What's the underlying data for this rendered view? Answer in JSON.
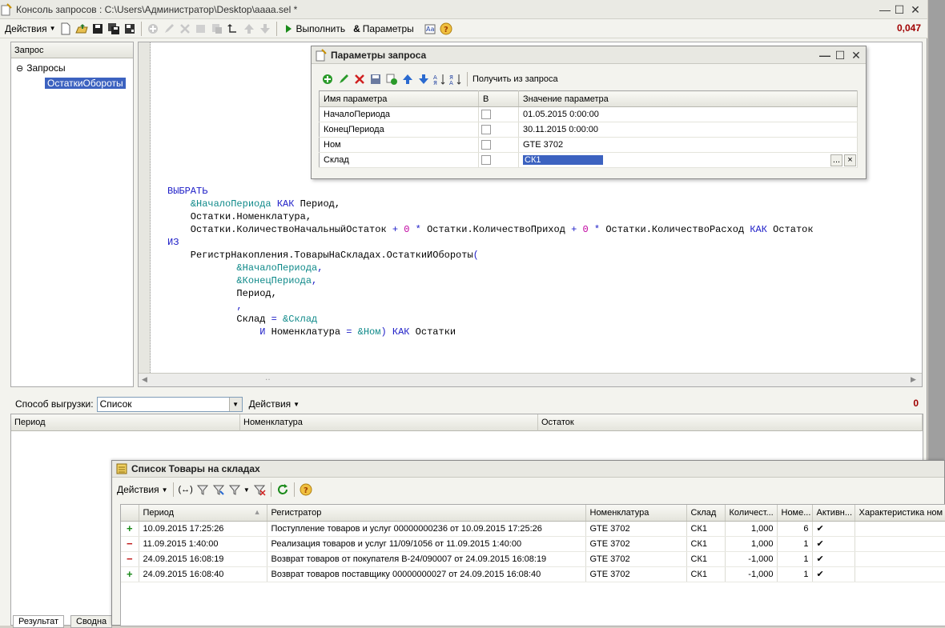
{
  "main_window": {
    "title": "Консоль запросов : C:\\Users\\Администратор\\Desktop\\aaaa.sel *"
  },
  "toolbar": {
    "actions_label": "Действия",
    "execute_label": "Выполнить",
    "parameters_label": "Параметры",
    "elapsed": "0,047"
  },
  "tree": {
    "header": "Запрос",
    "root": "Запросы",
    "selected": "ОстаткиОбороты"
  },
  "query_code": [
    [
      {
        "t": "ВЫБРАТЬ",
        "c": "kw"
      }
    ],
    [
      {
        "t": "    "
      },
      {
        "t": "&НачалоПериода",
        "c": "pr"
      },
      {
        "t": " "
      },
      {
        "t": "КАК",
        "c": "kw"
      },
      {
        "t": " Период,"
      }
    ],
    [
      {
        "t": "    Остатки.Номенклатура,"
      }
    ],
    [
      {
        "t": "    Остатки.КоличествоНачальныйОстаток "
      },
      {
        "t": "+",
        "c": "kw"
      },
      {
        "t": " "
      },
      {
        "t": "0",
        "c": "op"
      },
      {
        "t": " "
      },
      {
        "t": "*",
        "c": "kw"
      },
      {
        "t": " Остатки.КоличествоПриход "
      },
      {
        "t": "+",
        "c": "kw"
      },
      {
        "t": " "
      },
      {
        "t": "0",
        "c": "op"
      },
      {
        "t": " "
      },
      {
        "t": "*",
        "c": "kw"
      },
      {
        "t": " Остатки.КоличествоРасход "
      },
      {
        "t": "КАК",
        "c": "kw"
      },
      {
        "t": " Остаток"
      }
    ],
    [
      {
        "t": "ИЗ",
        "c": "kw"
      }
    ],
    [
      {
        "t": "    РегистрНакопления.ТоварыНаСкладах.ОстаткиИОбороты"
      },
      {
        "t": "(",
        "c": "kw"
      }
    ],
    [
      {
        "t": "            "
      },
      {
        "t": "&НачалоПериода",
        "c": "pr"
      },
      {
        "t": ",",
        "c": "kw"
      }
    ],
    [
      {
        "t": "            "
      },
      {
        "t": "&КонецПериода",
        "c": "pr"
      },
      {
        "t": ",",
        "c": "kw"
      }
    ],
    [
      {
        "t": "            Период,"
      }
    ],
    [
      {
        "t": "            "
      },
      {
        "t": ",",
        "c": "kw"
      }
    ],
    [
      {
        "t": "            Склад "
      },
      {
        "t": "=",
        "c": "kw"
      },
      {
        "t": " "
      },
      {
        "t": "&Склад",
        "c": "pr"
      }
    ],
    [
      {
        "t": "                "
      },
      {
        "t": "И",
        "c": "kw"
      },
      {
        "t": " Номенклатура "
      },
      {
        "t": "=",
        "c": "kw"
      },
      {
        "t": " "
      },
      {
        "t": "&Ном",
        "c": "pr"
      },
      {
        "t": ")",
        "c": "kw"
      },
      {
        "t": " "
      },
      {
        "t": "КАК",
        "c": "kw"
      },
      {
        "t": " Остатки"
      }
    ]
  ],
  "params_dialog": {
    "title": "Параметры запроса",
    "get_from_query_label": "Получить из запроса",
    "columns": [
      "Имя параметра",
      "В",
      "Значение параметра"
    ],
    "rows": [
      {
        "name": "НачалоПериода",
        "value": "01.05.2015 0:00:00"
      },
      {
        "name": "КонецПериода",
        "value": "30.11.2015 0:00:00"
      },
      {
        "name": "Ном",
        "value": "GTE 3702"
      },
      {
        "name": "Склад",
        "value": "СК1"
      }
    ],
    "ellipsis_label": "...",
    "clear_label": "×"
  },
  "result": {
    "export_label": "Способ выгрузки:",
    "export_value": "Список",
    "actions_label": "Действия",
    "count": "0",
    "columns": [
      "Период",
      "Номенклатура",
      "Остаток"
    ],
    "tabs": [
      "Результат",
      "Сводна"
    ]
  },
  "list_window": {
    "title": "Список Товары на складах",
    "actions_label": "Действия",
    "columns": [
      "Период",
      "Регистратор",
      "Номенклатура",
      "Склад",
      "Количест...",
      "Номе...",
      "Активн...",
      "Характеристика ном"
    ],
    "rows": [
      {
        "mark": "+",
        "period": "10.09.2015 17:25:26",
        "registrar": "Поступление товаров и услуг 00000000236 от 10.09.2015 17:25:26",
        "item": "GTE 3702",
        "warehouse": "СК1",
        "qty": "1,000",
        "line": "6",
        "active": "✔"
      },
      {
        "mark": "−",
        "period": "11.09.2015 1:40:00",
        "registrar": "Реализация товаров и услуг 11/09/1056 от 11.09.2015 1:40:00",
        "item": "GTE 3702",
        "warehouse": "СК1",
        "qty": "1,000",
        "line": "1",
        "active": "✔"
      },
      {
        "mark": "−",
        "period": "24.09.2015 16:08:19",
        "registrar": "Возврат товаров от покупателя В-24/090007 от 24.09.2015 16:08:19",
        "item": "GTE 3702",
        "warehouse": "СК1",
        "qty": "-1,000",
        "line": "1",
        "active": "✔"
      },
      {
        "mark": "+",
        "period": "24.09.2015 16:08:40",
        "registrar": "Возврат товаров поставщику 00000000027 от 24.09.2015 16:08:40",
        "item": "GTE 3702",
        "warehouse": "СК1",
        "qty": "-1,000",
        "line": "1",
        "active": "✔"
      }
    ]
  },
  "colors": {
    "accent": "#3c62c0",
    "count_red": "#a00000",
    "plus_green": "#1a8a1a",
    "minus_red": "#c01818"
  }
}
